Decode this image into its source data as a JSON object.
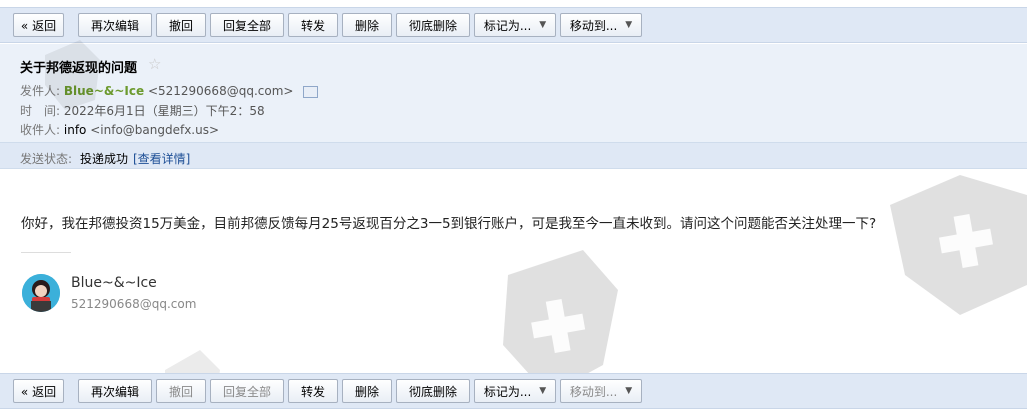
{
  "toolbar": {
    "back": "« 返回",
    "edit_again": "再次编辑",
    "recall": "撤回",
    "reply_all": "回复全部",
    "forward": "转发",
    "delete": "删除",
    "delete_permanently": "彻底删除",
    "mark_as": "标记为...",
    "move_to": "移动到..."
  },
  "email": {
    "subject": "关于邦德返现的问题",
    "from_label": "发件人:",
    "from_name": "Blue~&~Ice",
    "from_addr": "<521290668@qq.com>",
    "time_label": "时　间:",
    "time_value": "2022年6月1日（星期三）下午2：58",
    "to_label": "收件人:",
    "to_name": "info",
    "to_addr": "<info@bangdefx.us>",
    "status_label": "发送状态:",
    "status_value": "投递成功",
    "status_link": "[查看详情]",
    "body": "你好，我在邦德投资15万美金，目前邦德反馈每月25号返现百分之3一5到银行账户，可是我至今一直未收到。请问这个问题能否关注处理一下?"
  },
  "signature": {
    "name": "Blue~&~Ice",
    "email": "521290668@qq.com"
  },
  "icons": {
    "star": "star-icon",
    "contact": "contact-card-icon",
    "caret": "chevron-down-icon",
    "watermark": "shield-cross-watermark"
  }
}
